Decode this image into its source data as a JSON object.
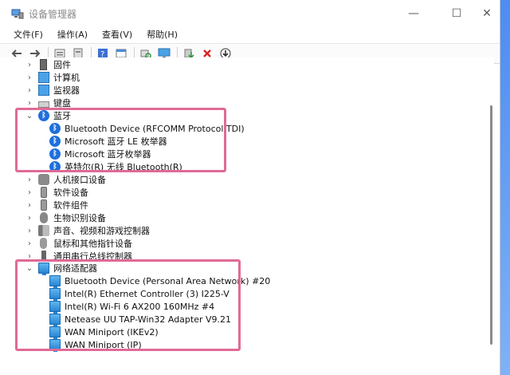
{
  "window": {
    "title": "设备管理器",
    "controls": {
      "minimize": "—",
      "maximize": "☐",
      "close": "✕"
    }
  },
  "menubar": {
    "items": [
      {
        "label": "文件(F)"
      },
      {
        "label": "操作(A)"
      },
      {
        "label": "查看(V)"
      },
      {
        "label": "帮助(H)"
      }
    ]
  },
  "toolbar": {
    "icons": [
      "back-arrow-icon",
      "forward-arrow-icon",
      "properties-icon",
      "drivers-icon",
      "help-icon",
      "view-icon",
      "scan-hardware-icon",
      "monitor-icon",
      "add-driver-icon",
      "uninstall-icon",
      "update-icon"
    ]
  },
  "tree": {
    "top_items": [
      {
        "label": "固件",
        "icon": "firmware-icon",
        "expander": "›"
      },
      {
        "label": "计算机",
        "icon": "computer-icon",
        "expander": "›"
      },
      {
        "label": "监视器",
        "icon": "monitor-icon",
        "expander": "›"
      },
      {
        "label": "键盘",
        "icon": "keyboard-icon",
        "expander": "›"
      }
    ],
    "bluetooth": {
      "label": "蓝牙",
      "expander": "⌄",
      "children": [
        {
          "label": "Bluetooth Device (RFCOMM Protocol TDI)"
        },
        {
          "label": "Microsoft 蓝牙 LE 枚举器"
        },
        {
          "label": "Microsoft 蓝牙枚举器"
        },
        {
          "label": "英特尔(R) 无线 Bluetooth(R)"
        }
      ]
    },
    "middle_items": [
      {
        "label": "人机接口设备",
        "icon": "hid-icon",
        "expander": "›"
      },
      {
        "label": "软件设备",
        "icon": "software-device-icon",
        "expander": "›"
      },
      {
        "label": "软件组件",
        "icon": "software-component-icon",
        "expander": "›"
      },
      {
        "label": "生物识别设备",
        "icon": "biometric-icon",
        "expander": "›"
      },
      {
        "label": "声音、视频和游戏控制器",
        "icon": "sound-icon",
        "expander": "›"
      },
      {
        "label": "鼠标和其他指针设备",
        "icon": "mouse-icon",
        "expander": "›"
      },
      {
        "label": "通用串行总线控制器",
        "icon": "usb-icon",
        "expander": "›"
      }
    ],
    "network": {
      "label": "网络适配器",
      "expander": "⌄",
      "children": [
        {
          "label": "Bluetooth Device (Personal Area Network) #20"
        },
        {
          "label": "Intel(R) Ethernet Controller (3) I225-V"
        },
        {
          "label": "Intel(R) Wi-Fi 6 AX200 160MHz #4"
        },
        {
          "label": "Netease UU TAP-Win32 Adapter V9.21"
        },
        {
          "label": "WAN Miniport (IKEv2)"
        },
        {
          "label": "WAN Miniport (IP)"
        }
      ]
    }
  },
  "colors": {
    "highlight": "#e06a96",
    "bluetooth": "#1f6fdc",
    "network": "#2a86d4"
  }
}
